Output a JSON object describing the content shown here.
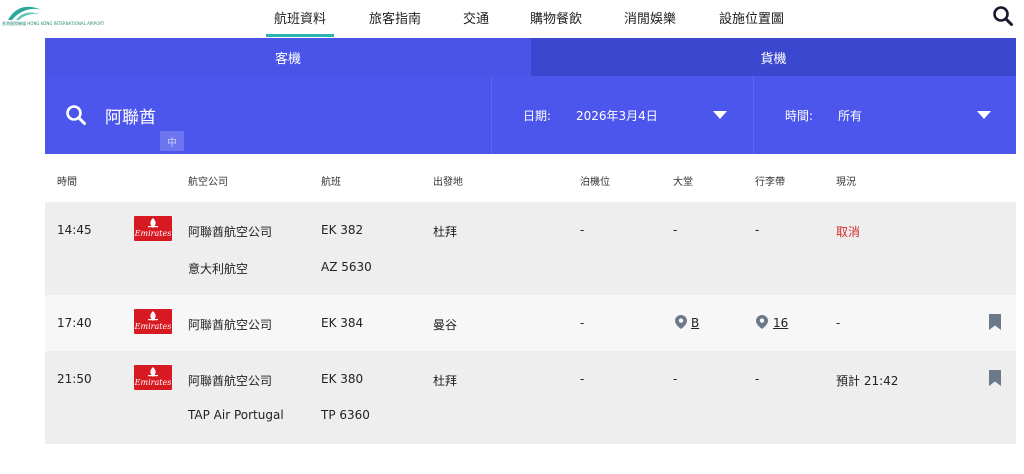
{
  "nav": {
    "logo_text_line1": "香港",
    "logo_text_line2": "國際機場",
    "logo_text_en1": "HONG KONG",
    "logo_text_en2": "INTERNATIONAL",
    "logo_text_en3": "AIRPORT",
    "items": [
      {
        "label": "航班資料",
        "active": true
      },
      {
        "label": "旅客指南"
      },
      {
        "label": "交通"
      },
      {
        "label": "購物餐飲"
      },
      {
        "label": "消閒娛樂"
      },
      {
        "label": "設施位置圖"
      }
    ],
    "search_icon": "search-icon"
  },
  "tabs": {
    "passenger": "客機",
    "cargo": "貨機"
  },
  "search": {
    "value": "阿聯酋",
    "ime_indicator": "中",
    "date_label": "日期:",
    "date_value": "2026年3月4日",
    "time_label": "時間:",
    "time_value": "所有"
  },
  "table": {
    "headers": {
      "time": "時間",
      "airline": "航空公司",
      "flight": "航班",
      "origin": "出發地",
      "stand": "泊機位",
      "hall": "大堂",
      "belt": "行李帶",
      "status": "現況"
    },
    "rows": [
      {
        "time": "14:45",
        "airline_logo": "Emirates",
        "airlines": [
          "阿聯酋航空公司",
          "意大利航空"
        ],
        "flights": [
          "EK 382",
          "AZ 5630"
        ],
        "origin": "杜拜",
        "stand": "-",
        "hall": "-",
        "belt": "-",
        "status": "取消"
      },
      {
        "time": "17:40",
        "airline_logo": "Emirates",
        "airlines": [
          "阿聯酋航空公司"
        ],
        "flights": [
          "EK 384"
        ],
        "origin": "曼谷",
        "stand": "-",
        "hall": "B",
        "belt": "16",
        "status": "-"
      },
      {
        "time": "21:50",
        "airline_logo": "Emirates",
        "airlines": [
          "阿聯酋航空公司",
          "TAP Air Portugal"
        ],
        "flights": [
          "EK 380",
          "TP 6360"
        ],
        "origin": "杜拜",
        "stand": "-",
        "hall": "-",
        "belt": "-",
        "status": "預計 21:42"
      }
    ]
  },
  "colors": {
    "primary_blue": "#4d56ec",
    "cargo_tab": "#3c47cf",
    "active_underline": "#2bb3b1",
    "cancel_red": "#d62b2b"
  }
}
